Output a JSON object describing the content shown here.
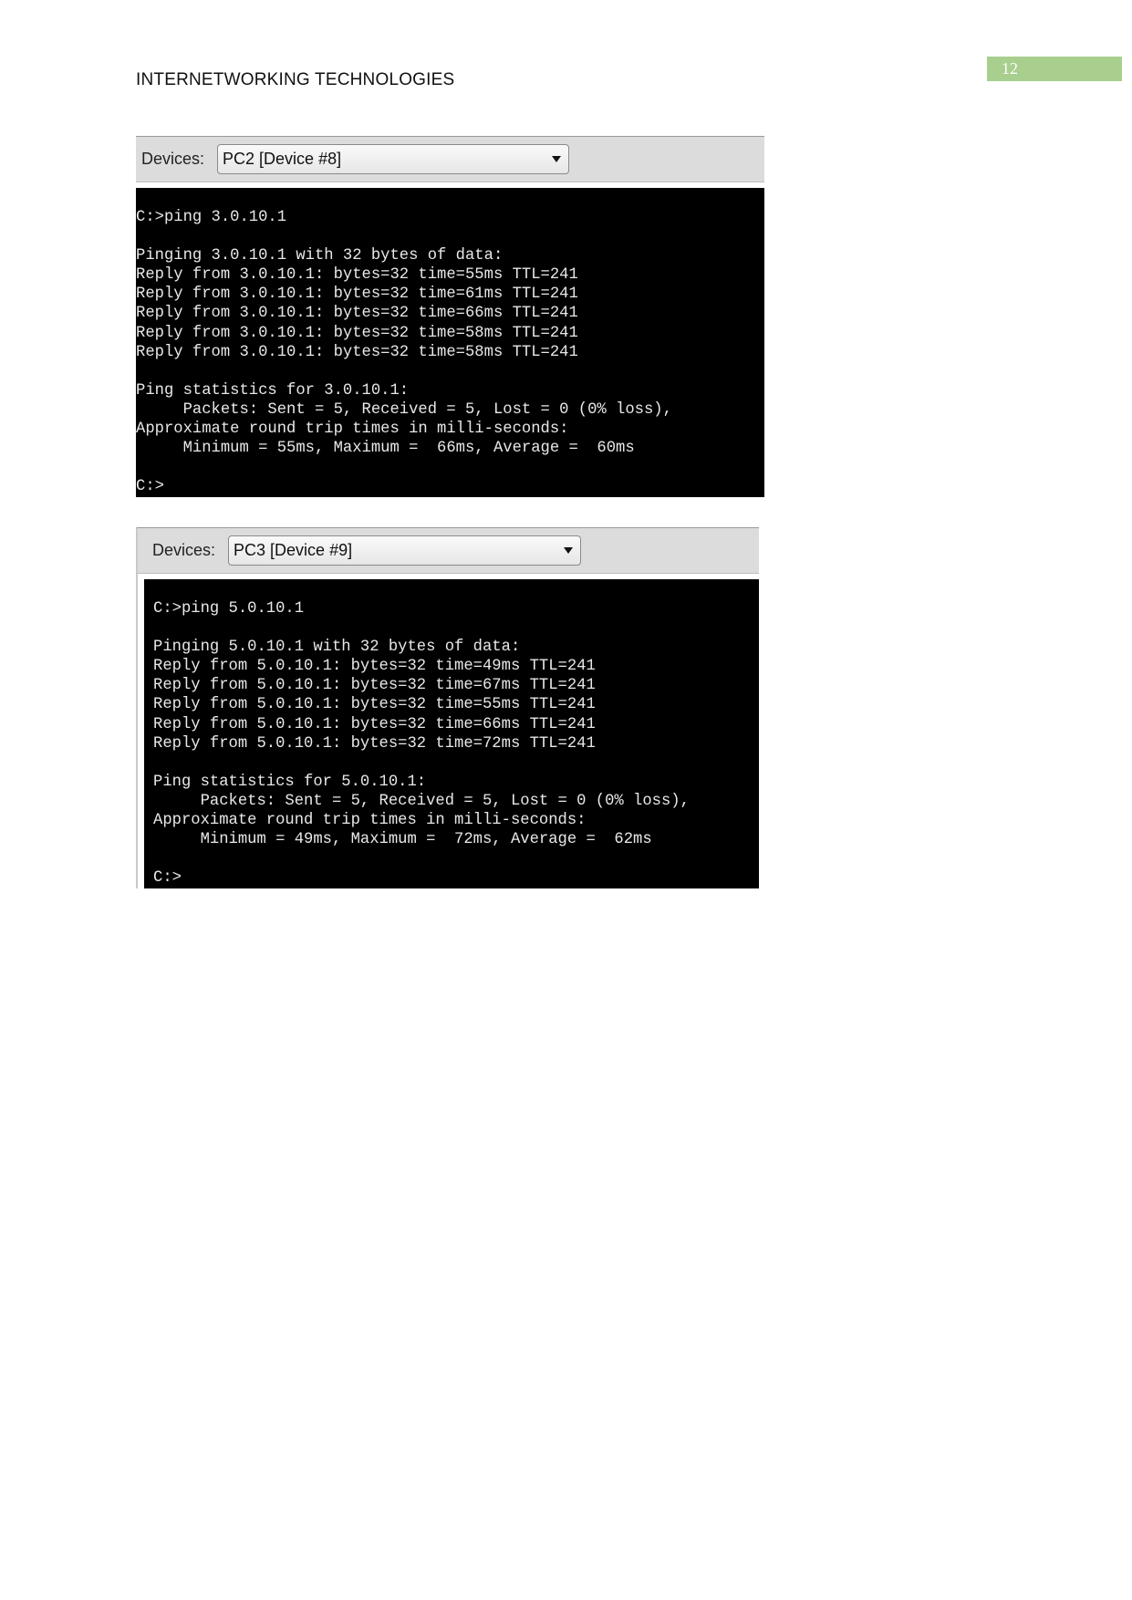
{
  "header": {
    "title": "INTERNETWORKING TECHNOLOGIES",
    "page_number": "12"
  },
  "panels": [
    {
      "devices_label": "Devices:",
      "selected_device": "PC2 [Device #8]",
      "terminal_lines": [
        "C:>ping 3.0.10.1",
        "",
        "Pinging 3.0.10.1 with 32 bytes of data:",
        "Reply from 3.0.10.1: bytes=32 time=55ms TTL=241",
        "Reply from 3.0.10.1: bytes=32 time=61ms TTL=241",
        "Reply from 3.0.10.1: bytes=32 time=66ms TTL=241",
        "Reply from 3.0.10.1: bytes=32 time=58ms TTL=241",
        "Reply from 3.0.10.1: bytes=32 time=58ms TTL=241",
        "",
        "Ping statistics for 3.0.10.1:",
        "     Packets: Sent = 5, Received = 5, Lost = 0 (0% loss),",
        "Approximate round trip times in milli-seconds:",
        "     Minimum = 55ms, Maximum =  66ms, Average =  60ms",
        "",
        "C:>"
      ]
    },
    {
      "devices_label": "Devices:",
      "selected_device": "PC3 [Device #9]",
      "terminal_lines": [
        "C:>ping 5.0.10.1",
        "",
        "Pinging 5.0.10.1 with 32 bytes of data:",
        "Reply from 5.0.10.1: bytes=32 time=49ms TTL=241",
        "Reply from 5.0.10.1: bytes=32 time=67ms TTL=241",
        "Reply from 5.0.10.1: bytes=32 time=55ms TTL=241",
        "Reply from 5.0.10.1: bytes=32 time=66ms TTL=241",
        "Reply from 5.0.10.1: bytes=32 time=72ms TTL=241",
        "",
        "Ping statistics for 5.0.10.1:",
        "     Packets: Sent = 5, Received = 5, Lost = 0 (0% loss),",
        "Approximate round trip times in milli-seconds:",
        "     Minimum = 49ms, Maximum =  72ms, Average =  62ms",
        "",
        "C:>"
      ]
    }
  ]
}
